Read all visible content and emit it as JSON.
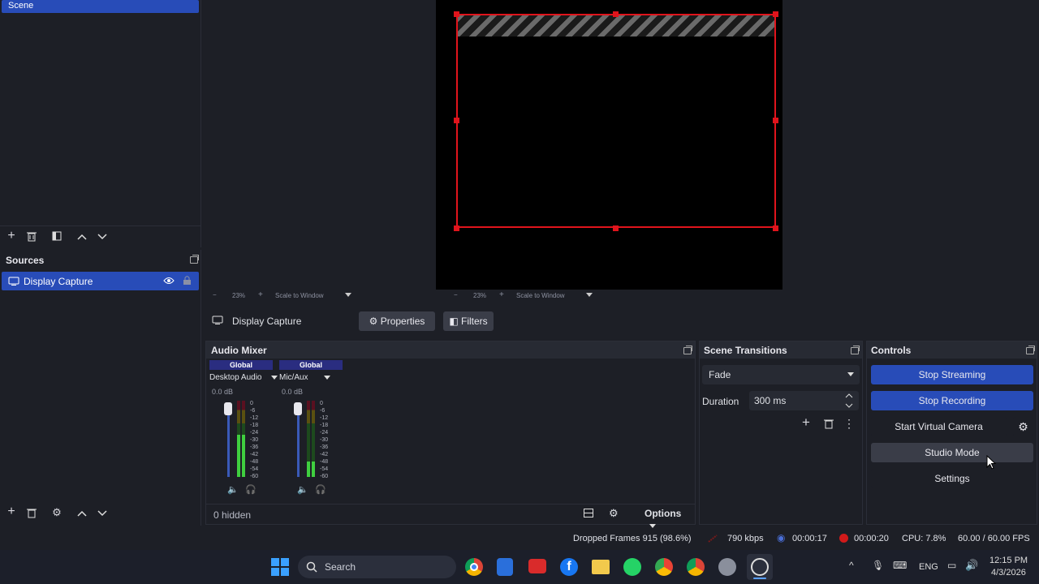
{
  "scenes": {
    "items": [
      {
        "label": "Scene"
      }
    ]
  },
  "sources": {
    "title": "Sources",
    "items": [
      {
        "label": "Display Capture"
      }
    ]
  },
  "preview_bar": {
    "left": {
      "minus": "−",
      "zoom": "23%",
      "plus": "+",
      "mode": "Scale to Window"
    },
    "right": {
      "minus": "−",
      "zoom": "23%",
      "plus": "+",
      "mode": "Scale to Window"
    }
  },
  "context_bar": {
    "source_label": "Display Capture",
    "properties": "Properties",
    "filters": "Filters"
  },
  "audio_mixer": {
    "title": "Audio Mixer",
    "hidden_label": "0 hidden",
    "options_label": "Options",
    "channels": [
      {
        "badge": "Global",
        "name": "Desktop Audio",
        "db": "0.0 dB",
        "level": 0.55
      },
      {
        "badge": "Global",
        "name": "Mic/Aux",
        "db": "0.0 dB",
        "level": 0.2
      }
    ],
    "scale": [
      "0",
      "-6",
      "-12",
      "-18",
      "-24",
      "-30",
      "-36",
      "-42",
      "-48",
      "-54",
      "-60"
    ]
  },
  "scene_transitions": {
    "title": "Scene Transitions",
    "transition": "Fade",
    "duration_label": "Duration",
    "duration_value": "300 ms"
  },
  "controls": {
    "title": "Controls",
    "stop_streaming": "Stop Streaming",
    "stop_recording": "Stop Recording",
    "start_virtual_camera": "Start Virtual Camera",
    "studio_mode": "Studio Mode",
    "settings": "Settings"
  },
  "status_bar": {
    "dropped_frames": "Dropped Frames 915 (98.6%)",
    "bitrate": "790 kbps",
    "stream_time": "00:00:17",
    "record_time": "00:00:20",
    "cpu": "CPU: 7.8%",
    "fps": "60.00 / 60.00 FPS"
  },
  "taskbar": {
    "search": "Search",
    "language": "ENG",
    "time": "12:15 PM",
    "date": "4/3/2026"
  },
  "colors": {
    "accent": "#284cb8",
    "panel": "#1d1f26",
    "record_red": "#d11a1a"
  }
}
